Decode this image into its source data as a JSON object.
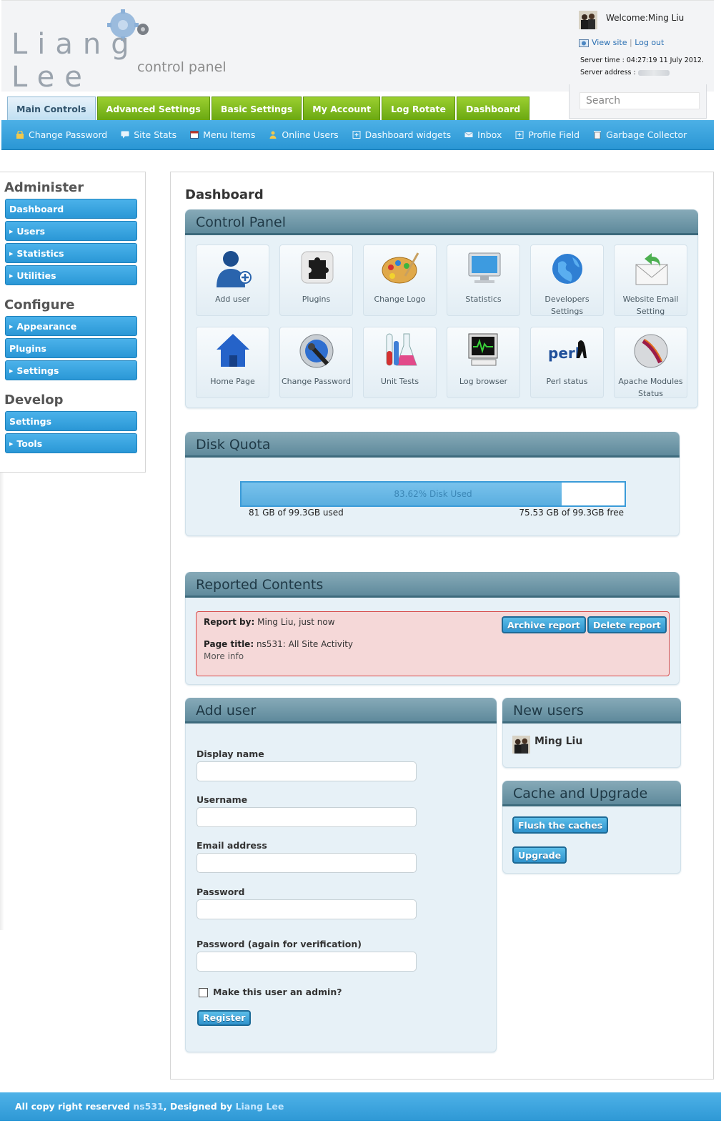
{
  "header": {
    "logo_name": "Liang Lee",
    "logo_sub": "control panel",
    "welcome": "Welcome:Ming Liu",
    "view_site": "View site",
    "separator": "|",
    "log_out": "Log out",
    "server_time": "Server time : 04:27:19 11 July 2012.",
    "server_address_label": "Server address :"
  },
  "tabs": [
    {
      "label": "Main Controls",
      "active": true
    },
    {
      "label": "Advanced Settings"
    },
    {
      "label": "Basic Settings"
    },
    {
      "label": "My Account"
    },
    {
      "label": "Log Rotate"
    },
    {
      "label": "Dashboard"
    }
  ],
  "search": {
    "placeholder": "Search"
  },
  "subnav": [
    {
      "label": "Change Password",
      "icon": "lock-icon"
    },
    {
      "label": "Site Stats",
      "icon": "chat-icon"
    },
    {
      "label": "Menu Items",
      "icon": "window-icon"
    },
    {
      "label": "Online Users",
      "icon": "user-icon"
    },
    {
      "label": "Dashboard widgets",
      "icon": "plus-box-icon"
    },
    {
      "label": "Inbox",
      "icon": "envelope-icon"
    },
    {
      "label": "Profile Field",
      "icon": "plus-box-icon"
    },
    {
      "label": "Garbage Collector",
      "icon": "trash-icon"
    }
  ],
  "sidebar": {
    "administer": {
      "title": "Administer",
      "items": [
        {
          "label": "Dashboard",
          "arrow": false
        },
        {
          "label": "Users",
          "arrow": true
        },
        {
          "label": "Statistics",
          "arrow": true
        },
        {
          "label": "Utilities",
          "arrow": true
        }
      ]
    },
    "configure": {
      "title": "Configure",
      "items": [
        {
          "label": "Appearance",
          "arrow": true
        },
        {
          "label": "Plugins",
          "arrow": false
        },
        {
          "label": "Settings",
          "arrow": true
        }
      ]
    },
    "develop": {
      "title": "Develop",
      "items": [
        {
          "label": "Settings",
          "arrow": false
        },
        {
          "label": "Tools",
          "arrow": true
        }
      ]
    }
  },
  "main": {
    "title": "Dashboard",
    "control_panel": {
      "title": "Control Panel",
      "tiles": [
        {
          "label": "Add user",
          "icon": "add-user-icon"
        },
        {
          "label": "Plugins",
          "icon": "puzzle-icon"
        },
        {
          "label": "Change Logo",
          "icon": "palette-icon"
        },
        {
          "label": "Statistics",
          "icon": "monitor-icon"
        },
        {
          "label": "Developers Settings",
          "icon": "globe-icon"
        },
        {
          "label": "Website Email Setting",
          "icon": "email-icon"
        },
        {
          "label": "Home Page",
          "icon": "home-icon"
        },
        {
          "label": "Change Password",
          "icon": "password-icon"
        },
        {
          "label": "Unit Tests",
          "icon": "flask-icon"
        },
        {
          "label": "Log browser",
          "icon": "log-icon"
        },
        {
          "label": "Perl status",
          "icon": "perl-icon"
        },
        {
          "label": "Apache Modules Status",
          "icon": "apache-icon"
        }
      ]
    },
    "disk_quota": {
      "title": "Disk Quota",
      "used_percent": 83.62,
      "bar_label": "83.62% Disk Used",
      "used_text": "81 GB of 99.3GB used",
      "free_text": "75.53 GB of 99.3GB free"
    },
    "reported": {
      "title": "Reported Contents",
      "report_by_label": "Report by:",
      "report_by_value": "Ming Liu, just now",
      "page_title_label": "Page title:",
      "page_title_value": "ns531: All Site Activity",
      "more_info": "More info",
      "archive_button": "Archive report",
      "delete_button": "Delete report"
    },
    "add_user": {
      "title": "Add user",
      "display_name": "Display name",
      "username": "Username",
      "email": "Email address",
      "password": "Password",
      "password_again": "Password (again for verification)",
      "admin_check": "Make this user an admin?",
      "register": "Register"
    },
    "new_users": {
      "title": "New users",
      "user": "Ming Liu"
    },
    "cache": {
      "title": "Cache and Upgrade",
      "flush": "Flush the caches",
      "upgrade": "Upgrade"
    }
  },
  "footer": {
    "text1": "All copy right reserved ",
    "site": "ns531",
    "text2": ", Designed by ",
    "designer": "Liang Lee"
  },
  "colors": {
    "tab_green": "#7bbb1c",
    "nav_blue": "#3aa3de",
    "panel_bg": "#e7f1f7",
    "panel_header": "#6f97a8",
    "report_bg": "#f5d8d8",
    "report_border": "#d74a4a"
  }
}
